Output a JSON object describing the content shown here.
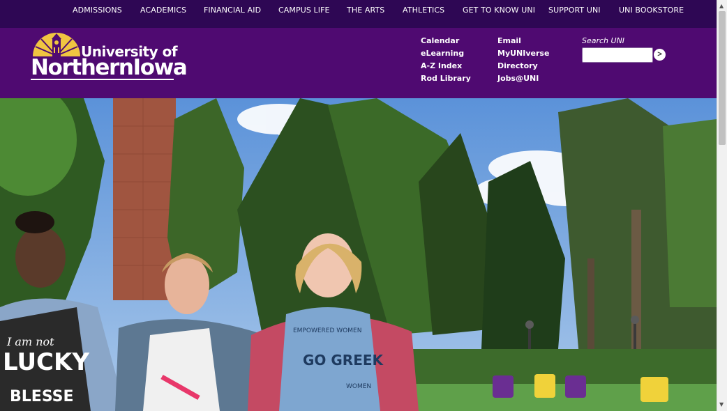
{
  "top_nav": [
    "ADMISSIONS",
    "ACADEMICS",
    "FINANCIAL AID",
    "CAMPUS LIFE",
    "THE ARTS",
    "ATHLETICS",
    "GET TO KNOW UNI",
    "SUPPORT UNI",
    "UNI BOOKSTORE"
  ],
  "logo": {
    "line1": "University of",
    "line2": "NorthernIowa"
  },
  "quick_links": {
    "col1": [
      "Calendar",
      "eLearning",
      "A-Z Index",
      "Rod Library"
    ],
    "col2": [
      "Email",
      "MyUNIverse",
      "Directory",
      "Jobs@UNI"
    ]
  },
  "search": {
    "label": "Search UNI",
    "value": "",
    "button": ">"
  },
  "hero": {
    "shirt_1": "I am not LUCKY I am BLESSED",
    "shirt_3_main": "GO GREEK",
    "shirt_3_small": "EMPOWERED WOMEN",
    "shirt_3_bottom": "WOMEN"
  },
  "colors": {
    "top_nav_bg": "#2e0754",
    "header_bg": "#4f0a71",
    "logo_gold": "#f0c541"
  }
}
